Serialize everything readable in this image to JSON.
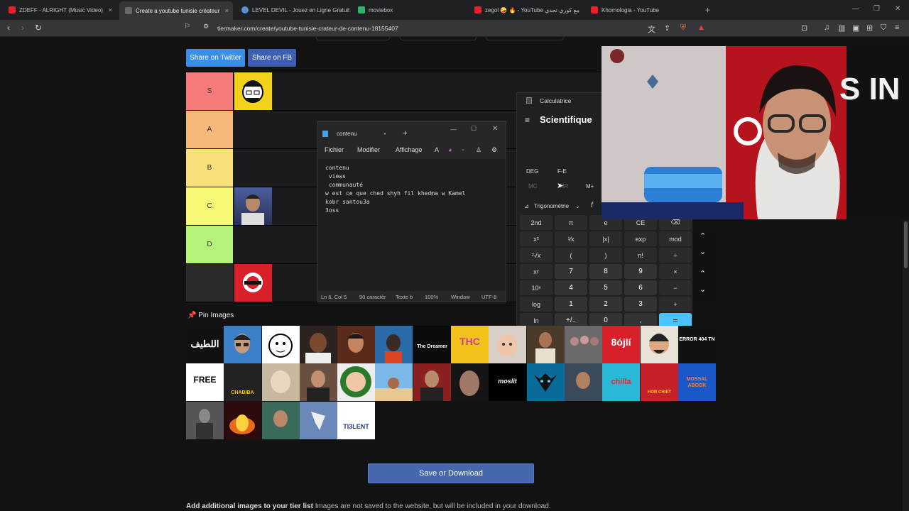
{
  "browser": {
    "tabs": [
      {
        "label": "ZDEFF - ALRIGHT (Music Video)",
        "color": "#e8202a"
      },
      {
        "label": "Create a youtube tunisie créateur",
        "color": "#3a3a3a"
      },
      {
        "label": "LEVEL DEVIL - Jouez en Ligne Gratuit",
        "color": "#5a8fd0"
      },
      {
        "label": "moviebox",
        "color": "#2fb36a"
      },
      {
        "label": "zegol 🤪 🔥 - YouTube مع كوري تحدي",
        "color": "#e8202a"
      },
      {
        "label": "Khornologia - YouTube",
        "color": "#e8202a"
      }
    ],
    "url": "tiermaker.com/create/youtube-tunisie-crateur-de-contenu-18155407"
  },
  "share": {
    "twitter": "Share on Twitter",
    "facebook": "Share on FB"
  },
  "tiers": [
    {
      "label": "S",
      "color": "#f47b7b"
    },
    {
      "label": "A",
      "color": "#f7b97a"
    },
    {
      "label": "B",
      "color": "#f7df7a"
    },
    {
      "label": "C",
      "color": "#f5f776"
    },
    {
      "label": "D",
      "color": "#b6f27a"
    },
    {
      "label": "",
      "color": "#2a2a2a"
    }
  ],
  "notepad": {
    "tab_title": "contenu",
    "menu": {
      "file": "Fichier",
      "edit": "Modifier",
      "view": "Affichage"
    },
    "content": "contenu\n views\n communauté\nw est ce que ched shyh fil khedma w Kamel\nkobr santou3a\n3oss",
    "status": {
      "position": "Ln 6, Col 5",
      "chars": "90 caractèr",
      "format": "Texte b",
      "zoom": "100%",
      "eol": "Window",
      "encoding": "UTF-8"
    }
  },
  "calculator": {
    "title": "Calculatrice",
    "mode": "Scientifique",
    "deg": "DEG",
    "fe": "F-E",
    "memory": [
      "MC",
      "MR",
      "M+"
    ],
    "trig": "Trigonométrie",
    "keys": [
      [
        "2nd",
        "π",
        "e",
        "CE",
        "⌫"
      ],
      [
        "x²",
        "¹⁄x",
        "|x|",
        "exp",
        "mod"
      ],
      [
        "²√x",
        "(",
        ")",
        "n!",
        "÷"
      ],
      [
        "xʸ",
        "7",
        "8",
        "9",
        "×"
      ],
      [
        "10ˣ",
        "4",
        "5",
        "6",
        "−"
      ],
      [
        "log",
        "1",
        "2",
        "3",
        "+"
      ],
      [
        "ln",
        "+/₋",
        "0",
        ",",
        "="
      ]
    ]
  },
  "pin_images_label": "Pin Images",
  "grid_texts": [
    "اللطيف",
    "The Dreamer",
    "THC",
    "8ójlí",
    "ERROR 404 TN",
    "FREE",
    "CHABIBA",
    "moslit",
    "chilla",
    "HOR CHIET",
    "MOSSAL ABOOK",
    "TI3LENT"
  ],
  "save_button": "Save or Download",
  "footer": {
    "bold": "Add additional images to your tier list",
    "rest": " Images are not saved to the website, but will be included in your download."
  }
}
